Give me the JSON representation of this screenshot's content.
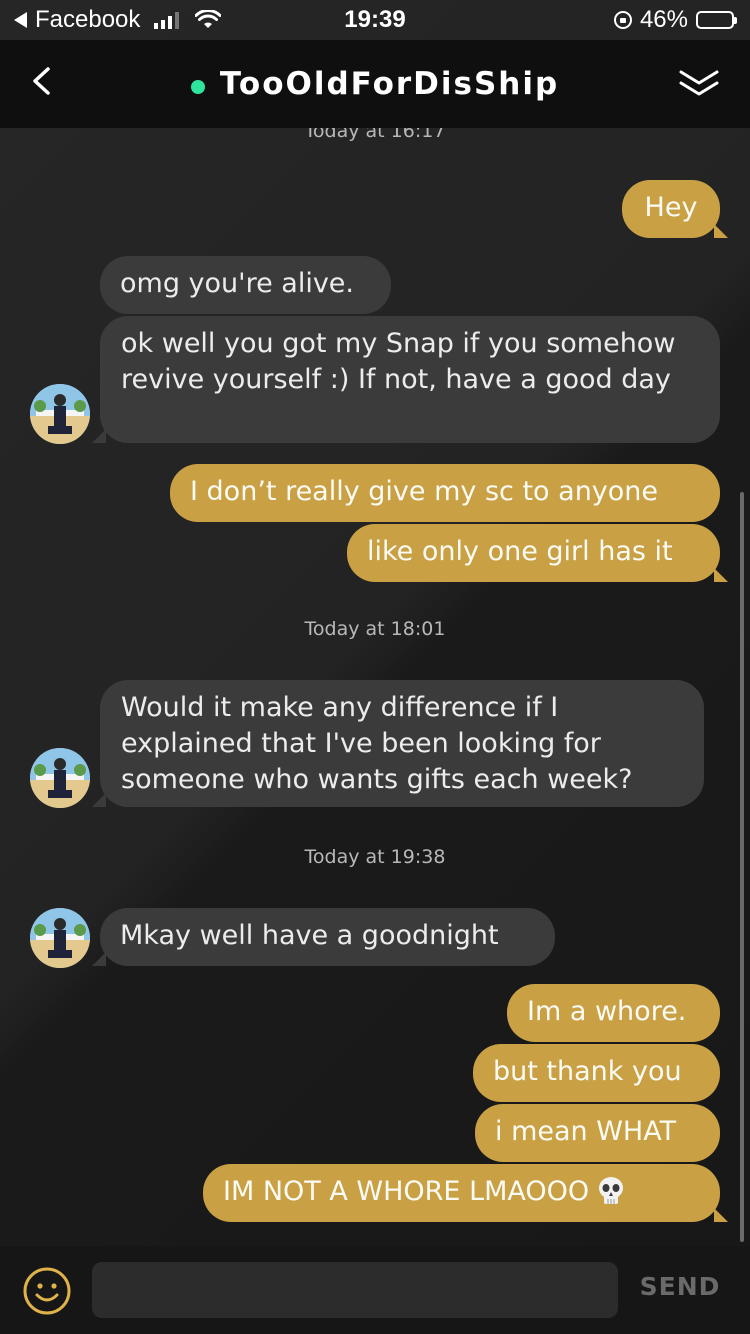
{
  "status_bar": {
    "back_app": "Facebook",
    "time": "19:39",
    "battery": "46%",
    "battery_level": 0.46
  },
  "header": {
    "title": "TooOldForDisShip",
    "online_color": "#2ee59d"
  },
  "conversation": {
    "timestamps": [
      "Today at 16:17",
      "Today at 18:01",
      "Today at 19:38"
    ],
    "messages": [
      {
        "from": "me",
        "text": "Hey"
      },
      {
        "from": "them",
        "text": "omg you're alive."
      },
      {
        "from": "them",
        "text": "ok well you got my Snap if you somehow revive yourself :) If not, have a good day"
      },
      {
        "from": "me",
        "text": "I don’t really give my sc to anyone"
      },
      {
        "from": "me",
        "text": "like only one girl has it"
      },
      {
        "from": "them",
        "text": "Would it make any difference if I explained that I've been looking for someone who wants gifts each week?"
      },
      {
        "from": "them",
        "text": "Mkay well have a goodnight"
      },
      {
        "from": "me",
        "text": "Im a whore."
      },
      {
        "from": "me",
        "text": "but thank you"
      },
      {
        "from": "me",
        "text": "i mean WHAT"
      },
      {
        "from": "me",
        "text": "IM NOT A WHORE LMAOOO",
        "emoji": "skull-emoji"
      }
    ]
  },
  "composer": {
    "placeholder": "",
    "send_label": "SEND"
  },
  "colors": {
    "outgoing_bubble": "#c9a044",
    "incoming_bubble": "#3b3b3b",
    "background": "#1e1e1e",
    "header": "#0f0f0f"
  }
}
